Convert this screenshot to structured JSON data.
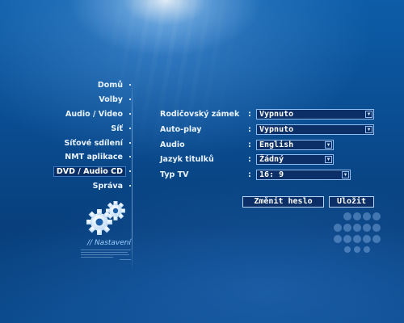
{
  "menu": {
    "items": [
      {
        "label": "Domů"
      },
      {
        "label": "Volby"
      },
      {
        "label": "Audio / Video"
      },
      {
        "label": "Síť"
      },
      {
        "label": "Síťové sdílení"
      },
      {
        "label": "NMT aplikace"
      },
      {
        "label": "DVD / Audio CD"
      },
      {
        "label": "Správa"
      }
    ],
    "active_index": 6
  },
  "section_title": "// Nastavení",
  "settings": [
    {
      "label": "Rodičovský zámek",
      "value": "Vypnuto"
    },
    {
      "label": "Auto-play",
      "value": "Vypnuto"
    },
    {
      "label": "Audio",
      "value": "English"
    },
    {
      "label": "Jazyk titulků",
      "value": "Žádný"
    },
    {
      "label": "Typ TV",
      "value": "16: 9"
    }
  ],
  "separator": ":",
  "buttons": {
    "change_password": "Změnit heslo",
    "save": "Uložit"
  },
  "icons": {
    "settings": "gears-icon",
    "dropdown": "chevron-down-icon",
    "brand": "dot-grid-logo"
  }
}
